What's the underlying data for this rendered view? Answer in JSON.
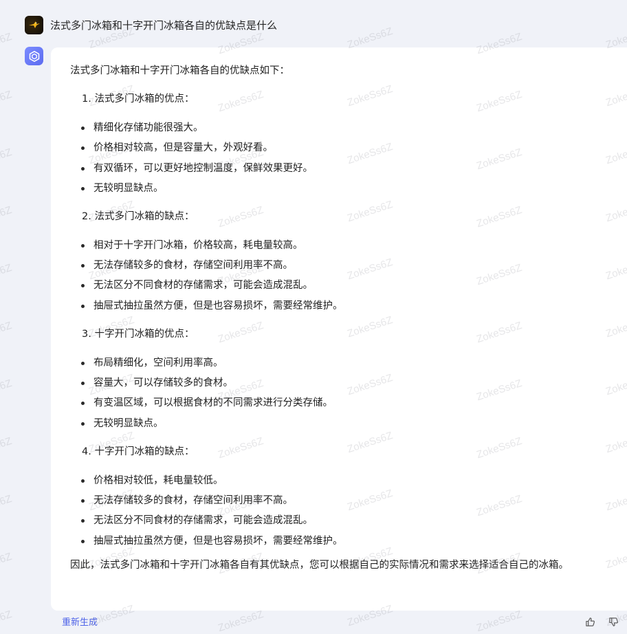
{
  "user": {
    "question": "法式多门冰箱和十字开门冰箱各自的优缺点是什么"
  },
  "answer": {
    "intro": "法式多门冰箱和十字开门冰箱各自的优缺点如下：",
    "sections": [
      {
        "title": "1. 法式多门冰箱的优点：",
        "items": [
          "精细化存储功能很强大。",
          "价格相对较高，但是容量大，外观好看。",
          "有双循环，可以更好地控制温度，保鲜效果更好。",
          "无较明显缺点。"
        ]
      },
      {
        "title": "2. 法式多门冰箱的缺点：",
        "items": [
          "相对于十字开门冰箱，价格较高，耗电量较高。",
          "无法存储较多的食材，存储空间利用率不高。",
          "无法区分不同食材的存储需求，可能会造成混乱。",
          "抽屉式抽拉虽然方便，但是也容易损坏，需要经常维护。"
        ]
      },
      {
        "title": "3. 十字开门冰箱的优点：",
        "items": [
          "布局精细化，空间利用率高。",
          "容量大，可以存储较多的食材。",
          "有变温区域，可以根据食材的不同需求进行分类存储。",
          "无较明显缺点。"
        ]
      },
      {
        "title": "4. 十字开门冰箱的缺点：",
        "items": [
          "价格相对较低，耗电量较低。",
          "无法存储较多的食材，存储空间利用率不高。",
          "无法区分不同食材的存储需求，可能会造成混乱。",
          "抽屉式抽拉虽然方便，但是也容易损坏，需要经常维护。"
        ]
      }
    ],
    "conclusion": "因此，法式多门冰箱和十字开门冰箱各自有其优缺点，您可以根据自己的实际情况和需求来选择适合自己的冰箱。"
  },
  "actions": {
    "regenerate_label": "重新生成",
    "thumb_up_icon": "thumb-up-icon",
    "thumb_down_icon": "thumb-down-icon"
  },
  "watermark": {
    "text": "ZokeSs6Z"
  },
  "colors": {
    "page_background": "#f0f2f8",
    "card_background": "#ffffff",
    "accent": "#4e63e8",
    "bot_avatar": "#6b7bf7"
  }
}
